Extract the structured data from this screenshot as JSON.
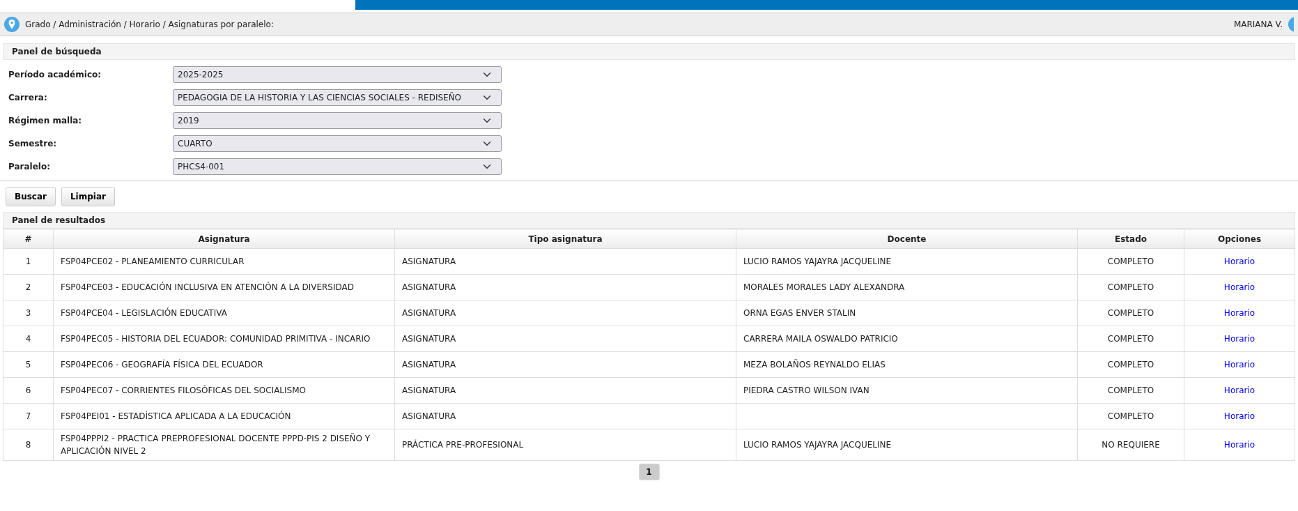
{
  "breadcrumb": "Grado / Administración / Horario / Asignaturas por paralelo:",
  "user": "MARIANA V.",
  "search_panel": {
    "title": "Panel de búsqueda",
    "fields": [
      {
        "label": "Período académico:",
        "value": "2025-2025"
      },
      {
        "label": "Carrera:",
        "value": "PEDAGOGIA DE LA HISTORIA Y LAS CIENCIAS SOCIALES - REDISEÑO"
      },
      {
        "label": "Régimen malla:",
        "value": "2019"
      },
      {
        "label": "Semestre:",
        "value": "CUARTO"
      },
      {
        "label": "Paralelo:",
        "value": "PHCS4-001"
      }
    ],
    "buttons": [
      "Buscar",
      "Limpiar"
    ]
  },
  "results_panel": {
    "title": "Panel de resultados",
    "columns": [
      "#",
      "Asignatura",
      "Tipo asignatura",
      "Docente",
      "Estado",
      "Opciones"
    ],
    "rows": [
      {
        "n": "1",
        "asignatura": "FSP04PCE02 - PLANEAMIENTO CURRICULAR",
        "tipo": "ASIGNATURA",
        "docente": "LUCIO RAMOS YAJAYRA JACQUELINE",
        "estado": "COMPLETO",
        "opcion": "Horario"
      },
      {
        "n": "2",
        "asignatura": "FSP04PCE03 - EDUCACIÓN INCLUSIVA EN ATENCIÓN A LA DIVERSIDAD",
        "tipo": "ASIGNATURA",
        "docente": "MORALES MORALES LADY ALEXANDRA",
        "estado": "COMPLETO",
        "opcion": "Horario"
      },
      {
        "n": "3",
        "asignatura": "FSP04PCE04 - LEGISLACIÓN EDUCATIVA",
        "tipo": "ASIGNATURA",
        "docente": "ORNA EGAS ENVER STALIN",
        "estado": "COMPLETO",
        "opcion": "Horario"
      },
      {
        "n": "4",
        "asignatura": "FSP04PEC05 - HISTORIA DEL ECUADOR: COMUNIDAD PRIMITIVA - INCARIO",
        "tipo": "ASIGNATURA",
        "docente": "CARRERA MAILA OSWALDO PATRICIO",
        "estado": "COMPLETO",
        "opcion": "Horario"
      },
      {
        "n": "5",
        "asignatura": "FSP04PEC06 - GEOGRAFÍA FÍSICA DEL ECUADOR",
        "tipo": "ASIGNATURA",
        "docente": "MEZA BOLAÑOS REYNALDO ELIAS",
        "estado": "COMPLETO",
        "opcion": "Horario"
      },
      {
        "n": "6",
        "asignatura": "FSP04PEC07 - CORRIENTES FILOSÓFICAS DEL SOCIALISMO",
        "tipo": "ASIGNATURA",
        "docente": "PIEDRA CASTRO WILSON IVAN",
        "estado": "COMPLETO",
        "opcion": "Horario"
      },
      {
        "n": "7",
        "asignatura": "FSP04PEI01 - ESTADÍSTICA APLICADA A LA EDUCACIÓN",
        "tipo": "ASIGNATURA",
        "estado": "COMPLETO",
        "opcion": "Horario"
      },
      {
        "n": "8",
        "asignatura": "FSP04PPPI2 - PRACTICA PREPROFESIONAL DOCENTE PPPD-PIS 2 DISEÑO Y APLICACIÓN NIVEL 2",
        "tipo": "PRÁCTICA PRE-PROFESIONAL",
        "docente": "LUCIO RAMOS YAJAYRA JACQUELINE",
        "estado": "NO REQUIERE",
        "opcion": "Horario"
      }
    ],
    "pagination": [
      {
        "label": "1",
        "selected": true
      }
    ]
  }
}
